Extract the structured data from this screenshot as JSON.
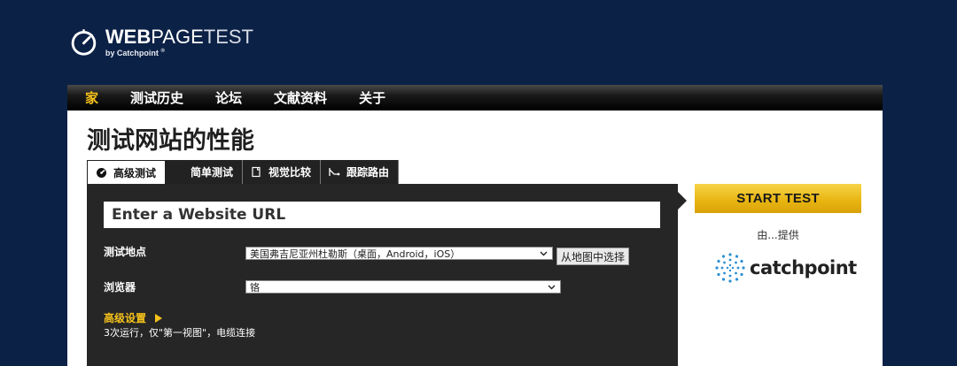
{
  "logo": {
    "word_bold": "WEB",
    "word_mid": "PAGE",
    "word_thin": "TEST",
    "byline": "by Catchpoint",
    "registered": "®"
  },
  "nav": [
    {
      "label": "家"
    },
    {
      "label": "测试历史"
    },
    {
      "label": "论坛"
    },
    {
      "label": "文献资料"
    },
    {
      "label": "关于"
    }
  ],
  "page_title": "测试网站的性能",
  "tabs": [
    {
      "label": "高级测试",
      "icon": "gauge-icon",
      "active": true
    },
    {
      "label": "简单测试",
      "icon": "",
      "active": false
    },
    {
      "label": "视觉比较",
      "icon": "document-compare-icon",
      "active": false
    },
    {
      "label": "跟踪路由",
      "icon": "route-icon",
      "active": false
    }
  ],
  "form": {
    "url_placeholder": "Enter a Website URL",
    "location_label": "测试地点",
    "location_value": "美国弗吉尼亚州杜勒斯（桌面，Android，iOS）",
    "map_button": "从地图中选择",
    "browser_label": "浏览器",
    "browser_value": "铬",
    "advanced_label": "高级设置",
    "advanced_desc": "3次运行，仅\"第一视图\"，电缆连接"
  },
  "sidebar": {
    "start_button": "START TEST",
    "provided_by": "由...提供",
    "sponsor": "catchpoint"
  },
  "colors": {
    "background": "#0c2146",
    "accent": "#f6c21a",
    "panel": "#262626"
  }
}
